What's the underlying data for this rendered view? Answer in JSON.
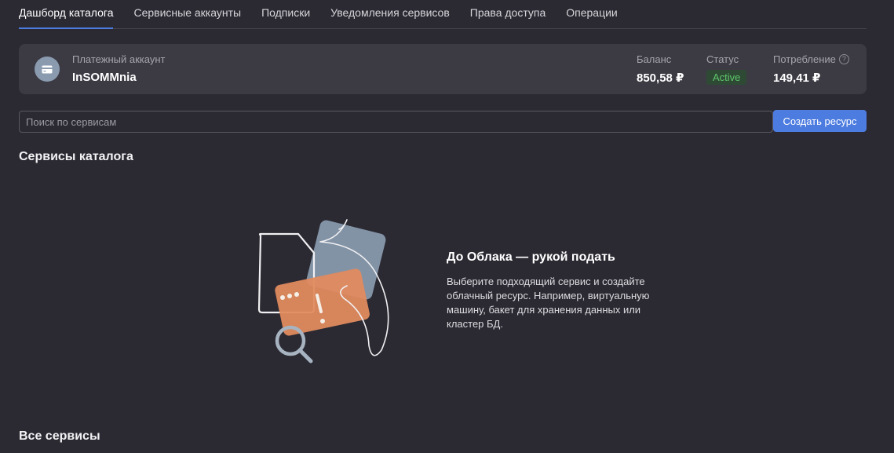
{
  "tabs": [
    {
      "label": "Дашборд каталога",
      "active": true
    },
    {
      "label": "Сервисные аккаунты",
      "active": false
    },
    {
      "label": "Подписки",
      "active": false
    },
    {
      "label": "Уведомления сервисов",
      "active": false
    },
    {
      "label": "Права доступа",
      "active": false
    },
    {
      "label": "Операции",
      "active": false
    }
  ],
  "billing": {
    "account_label": "Платежный аккаунт",
    "account_name": "InSOMMnia",
    "balance_label": "Баланс",
    "balance_value": "850,58 ₽",
    "status_label": "Статус",
    "status_value": "Active",
    "consumption_label": "Потребление",
    "consumption_value": "149,41 ₽",
    "help_glyph": "?",
    "icon": "credit-card-icon"
  },
  "search": {
    "placeholder": "Поиск по сервисам",
    "value": ""
  },
  "create_button": "Создать ресурс",
  "catalog_services_title": "Сервисы каталога",
  "empty_state": {
    "title": "До Облака — рукой подать",
    "text": "Выберите подходящий сервис и создайте облачный ресурс. Например, виртуальную машину, бакет для хранения данных или кластер БД.",
    "illustration": "empty-services-illustration"
  },
  "all_services_title": "Все сервисы",
  "colors": {
    "background": "#2b2a33",
    "card": "#3c3b44",
    "accent": "#4d7ce0",
    "status_green": "#5fc66a"
  }
}
